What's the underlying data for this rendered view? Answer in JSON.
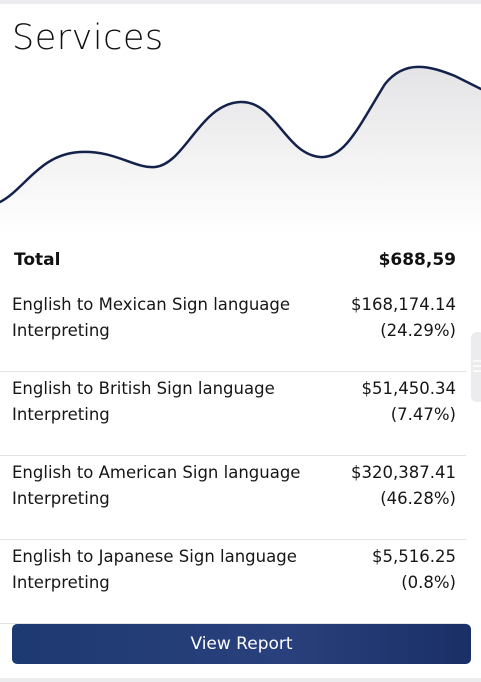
{
  "header": {
    "title": "Services"
  },
  "chart": {
    "line_color": "#13224a",
    "fill_top": "#e8e8ea",
    "fill_bottom": "#ffffff"
  },
  "summary": {
    "total_label": "Total",
    "total_value": "$688,59",
    "items": [
      {
        "name": "English to Mexican Sign language Interpreting",
        "amount": "$168,174.14",
        "percent": "(24.29%)"
      },
      {
        "name": "English to British Sign language Interpreting",
        "amount": "$51,450.34",
        "percent": "(7.47%)"
      },
      {
        "name": "English to American Sign language Interpreting",
        "amount": "$320,387.41",
        "percent": "(46.28%)"
      },
      {
        "name": "English to Japanese Sign language Interpreting",
        "amount": "$5,516.25",
        "percent": "(0.8%)"
      }
    ]
  },
  "actions": {
    "view_report_label": "View Report"
  },
  "colors": {
    "button": "#1e3a72",
    "text": "#111111",
    "divider": "#e2e2e2"
  }
}
